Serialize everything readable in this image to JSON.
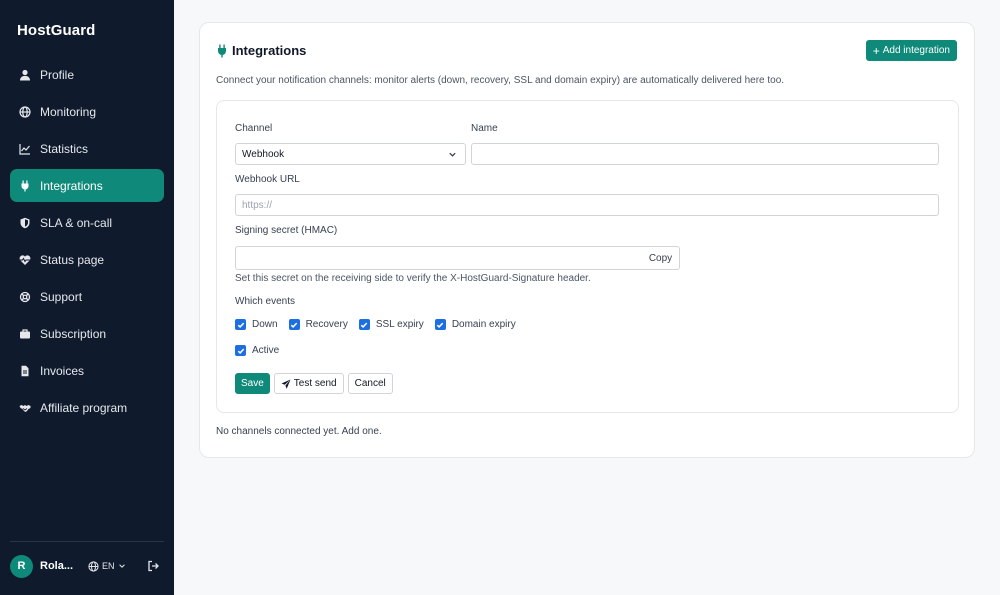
{
  "app": {
    "brand": "HostGuard"
  },
  "sidebar": {
    "items": [
      {
        "label": "Profile",
        "icon": "user-icon",
        "active": false
      },
      {
        "label": "Monitoring",
        "icon": "globe-icon",
        "active": false
      },
      {
        "label": "Statistics",
        "icon": "line-chart-icon",
        "active": false
      },
      {
        "label": "Integrations",
        "icon": "plug-icon",
        "active": true
      },
      {
        "label": "SLA & on-call",
        "icon": "shield-icon",
        "active": false
      },
      {
        "label": "Status page",
        "icon": "heart-pulse-icon",
        "active": false
      },
      {
        "label": "Support",
        "icon": "lifebuoy-icon",
        "active": false
      },
      {
        "label": "Subscription",
        "icon": "briefcase-icon",
        "active": false
      },
      {
        "label": "Invoices",
        "icon": "document-icon",
        "active": false
      },
      {
        "label": "Affiliate program",
        "icon": "handshake-icon",
        "active": false
      }
    ],
    "user": {
      "initial": "R",
      "name": "Rola..."
    },
    "language": "EN"
  },
  "integrations": {
    "title": "Integrations",
    "add_button": "Add integration",
    "description": "Connect your notification channels: monitor alerts (down, recovery, SSL and domain expiry) are automatically delivered here too.",
    "form": {
      "channel_label": "Channel",
      "channel_value": "Webhook",
      "name_label": "Name",
      "name_value": "",
      "url_label": "Webhook URL",
      "url_placeholder": "https://",
      "secret_label": "Signing secret (HMAC)",
      "secret_value": "",
      "copy_button": "Copy",
      "secret_hint": "Set this secret on the receiving side to verify the X-HostGuard-Signature header.",
      "events_label": "Which events",
      "events": [
        {
          "label": "Down",
          "checked": true
        },
        {
          "label": "Recovery",
          "checked": true
        },
        {
          "label": "SSL expiry",
          "checked": true
        },
        {
          "label": "Domain expiry",
          "checked": true
        }
      ],
      "active_label": "Active",
      "active_checked": true,
      "save_button": "Save",
      "test_button": "Test send",
      "cancel_button": "Cancel"
    },
    "empty_text": "No channels connected yet. Add one."
  },
  "colors": {
    "sidebar_bg": "#0f1b2d",
    "accent": "#0f8a7a",
    "checkbox": "#1d6fe0"
  }
}
